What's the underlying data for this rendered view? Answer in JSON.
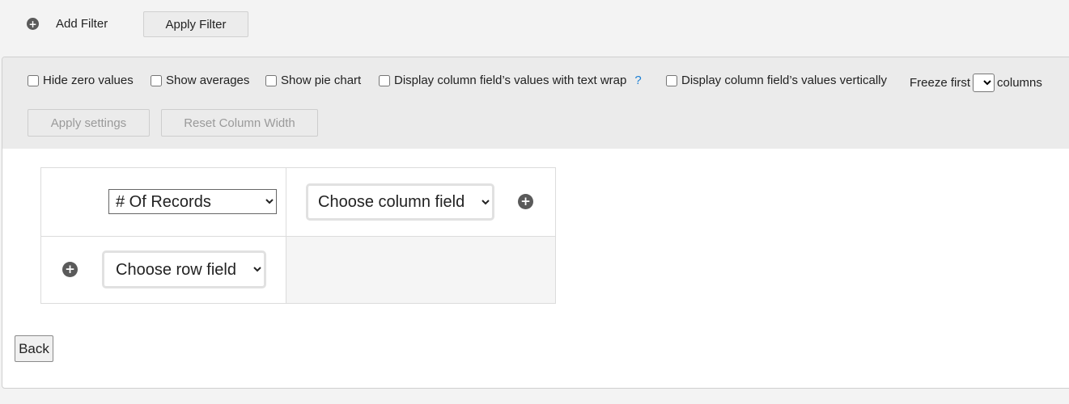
{
  "filter_bar": {
    "add_filter_label": "Add Filter",
    "apply_filter_label": "Apply Filter",
    "add_icon": "plus-circle-icon"
  },
  "settings": {
    "hide_zero_label": "Hide zero values",
    "hide_zero_checked": false,
    "show_averages_label": "Show averages",
    "show_averages_checked": false,
    "show_pie_label": "Show pie chart",
    "show_pie_checked": false,
    "text_wrap_label": "Display column field’s values with text wrap",
    "text_wrap_checked": false,
    "help_mark": "?",
    "vertical_label": "Display column field’s values vertically",
    "vertical_checked": false,
    "freeze_prefix": "Freeze first",
    "freeze_value": "",
    "freeze_suffix": "columns",
    "apply_settings_label": "Apply settings",
    "reset_width_label": "Reset Column Width"
  },
  "pivot": {
    "value_field": "# Of Records",
    "column_field_placeholder": "Choose column field",
    "row_field_placeholder": "Choose row field"
  },
  "footer": {
    "back_label": "Back"
  },
  "colors": {
    "page_bg": "#f3f3f3",
    "settings_bg": "#ebebeb",
    "help_blue": "#1a7fd4",
    "icon_gray": "#5a5a5a"
  }
}
